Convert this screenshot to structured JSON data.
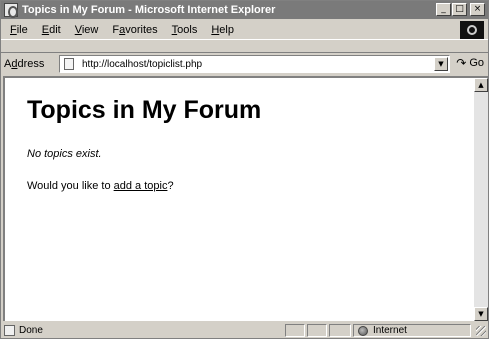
{
  "window": {
    "title": "Topics in My Forum - Microsoft Internet Explorer",
    "minimize": "_",
    "maximize": "□",
    "close": "×"
  },
  "menu": [
    {
      "mnemonic": "F",
      "rest": "ile"
    },
    {
      "mnemonic": "E",
      "rest": "dit"
    },
    {
      "mnemonic": "V",
      "rest": "iew"
    },
    {
      "pre": "F",
      "mnemonic": "a",
      "rest": "vorites"
    },
    {
      "mnemonic": "T",
      "rest": "ools"
    },
    {
      "mnemonic": "H",
      "rest": "elp"
    }
  ],
  "address": {
    "label_pre": "A",
    "label_mnemonic": "d",
    "label_rest": "dress",
    "value": "http://localhost/topiclist.php",
    "go": "Go"
  },
  "page": {
    "title": "Topics in My Forum",
    "empty_message": "No topics exist.",
    "prompt_before": "Would you like to ",
    "link_text": "add a topic",
    "prompt_after": "?"
  },
  "status": {
    "text": "Done",
    "zone": "Internet"
  },
  "icons": {
    "app": "ie-page-icon",
    "logo": "ie-logo-icon",
    "go": "go-arrow-icon",
    "zone": "globe-icon"
  }
}
